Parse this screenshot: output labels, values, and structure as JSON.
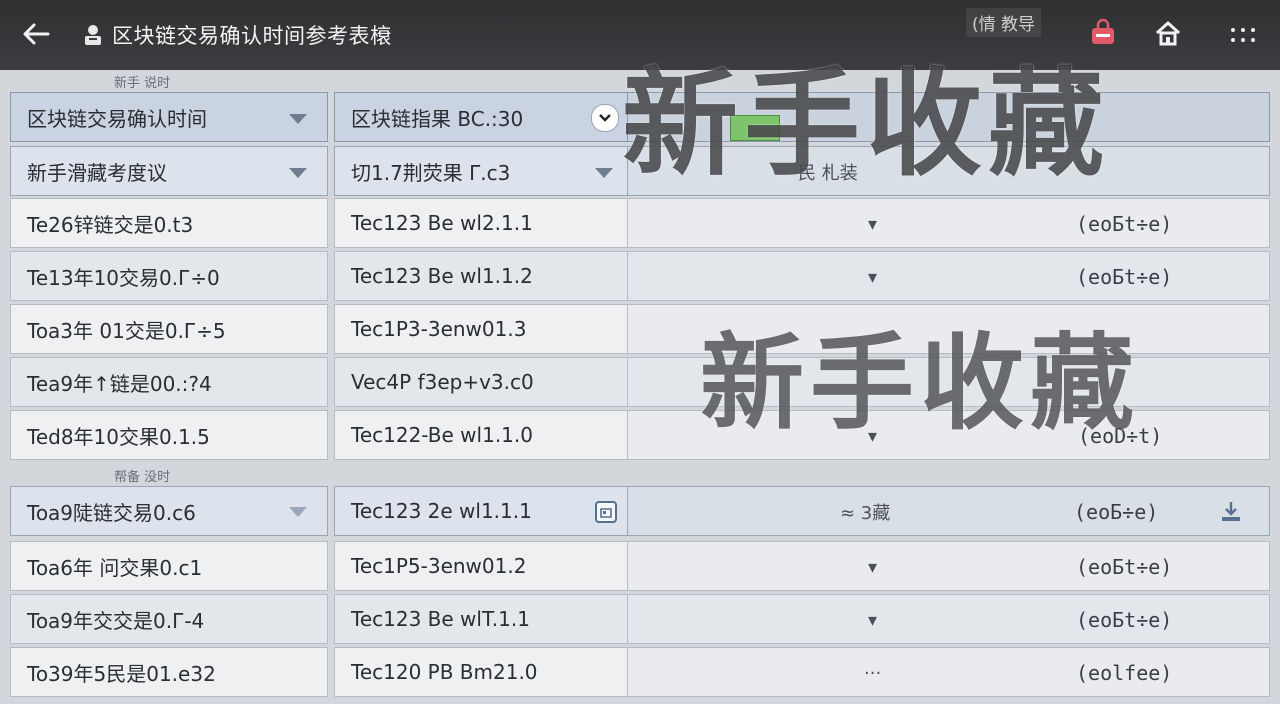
{
  "topbar": {
    "title": "区块链交易确认时间参考表榱",
    "badge": "(情  教导"
  },
  "groups": {
    "first_label": "新手 说时",
    "second_label": "帮备 没时"
  },
  "header": {
    "col1": "区块链交易确认时间",
    "col2": "区块链指果 BC.:30"
  },
  "subheader": {
    "col1": "新手滑藏考度议",
    "col2": "切1.7荆荧果 Γ.c3",
    "mid": "民    札装"
  },
  "rows_a": [
    {
      "c1": "Te26锌链交是0.t3",
      "c2": "Tec123 Be wl2.1.1",
      "mid": "▾",
      "tag": "(eoБt÷e)"
    },
    {
      "c1": "Te13年10交易0.Г÷0",
      "c2": "Tec123 Be wl1.1.2",
      "mid": "▾",
      "tag": "(eoБt÷e)"
    },
    {
      "c1": "Toa3年 01交是0.Г÷5",
      "c2": "Tec1P3-3enw01.3",
      "mid": "",
      "tag": ""
    },
    {
      "c1": "Tea9年↑链是00.:?4",
      "c2": "Vec4P f3ep+v3.c0",
      "mid": "",
      "tag": ""
    },
    {
      "c1": "Ted8年10交果0.1.5",
      "c2": "Tec122-Be wl1.1.0",
      "mid": "▾",
      "tag": "(eoD÷t)"
    }
  ],
  "rows_b": [
    {
      "c1": "Toa9陡链交易0.c6",
      "c2": "Tec123 2e wl1.1.1",
      "mid": "≈ 3藏",
      "tag": "(eoБ÷e)"
    },
    {
      "c1": "Toa6年 问交果0.c1",
      "c2": "Tec1P5-3enw01.2",
      "mid": "▾",
      "tag": "(eoБt÷e)"
    },
    {
      "c1": "Toa9年交交是0.Г-4",
      "c2": "Tec123 Be wlT.1.1",
      "mid": "▾",
      "tag": "(eoБt÷e)"
    },
    {
      "c1": "To39年5民是01.e32",
      "c2": "Tec120 PB Bm21.0",
      "mid": "···",
      "tag": "(eolfee)"
    }
  ],
  "watermark": {
    "large": "新手收藏",
    "second": "新手收藏"
  }
}
